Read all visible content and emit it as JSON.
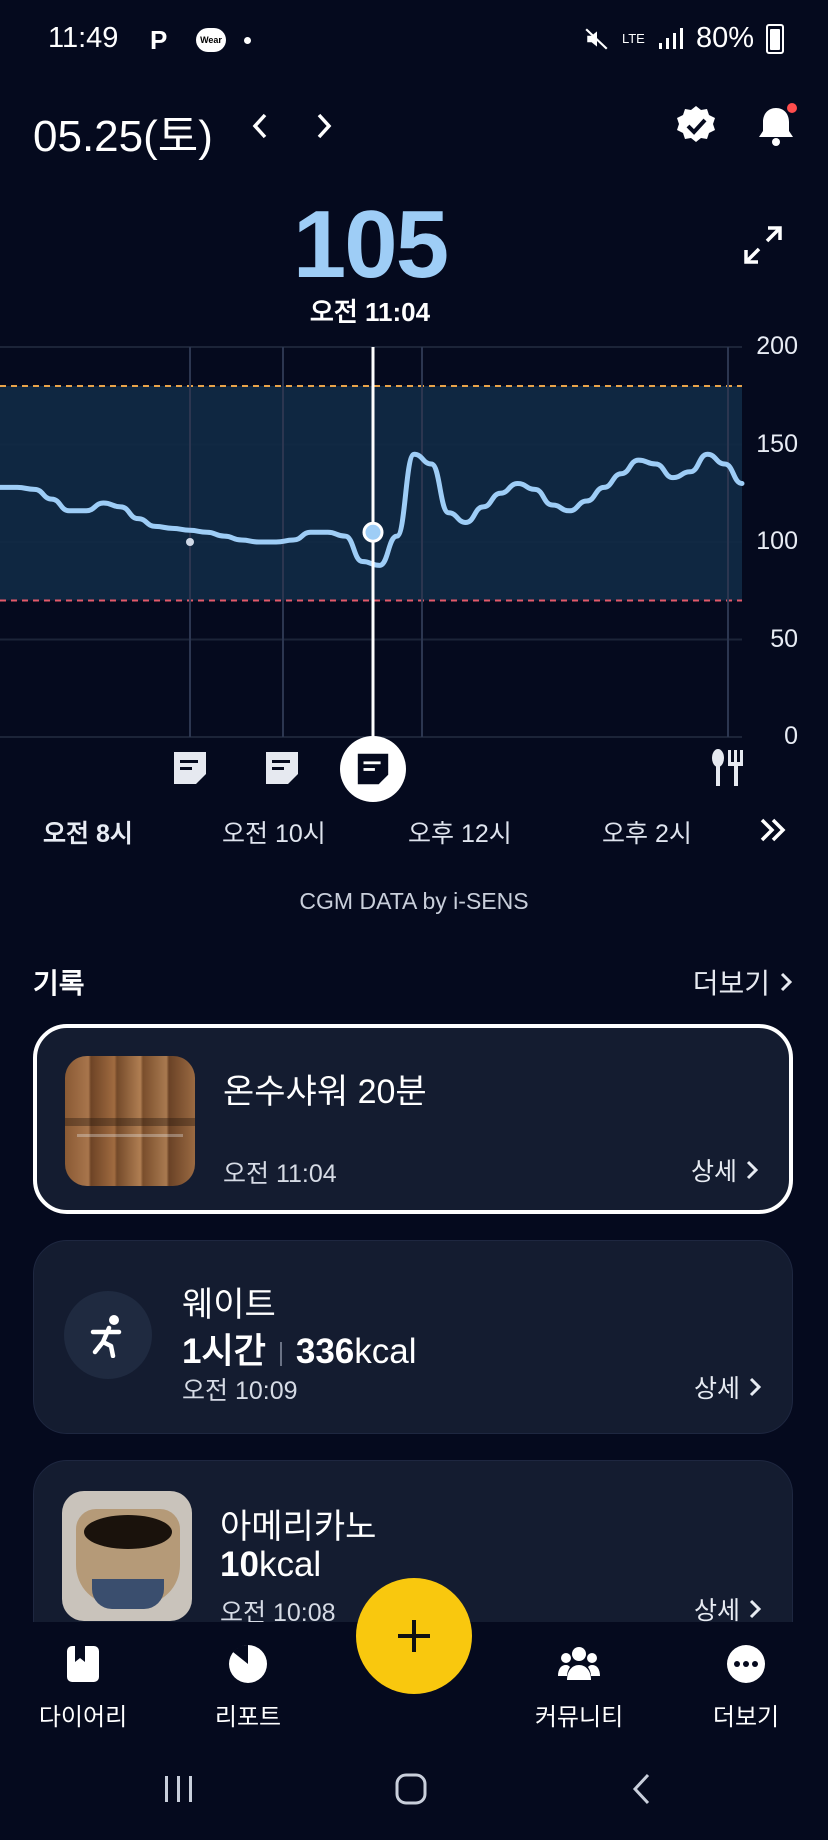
{
  "status_bar": {
    "time": "11:49",
    "wear_label": "Wear",
    "network": "LTE",
    "battery": "80%"
  },
  "header": {
    "date": "05.25(토)",
    "prev_icon": "chevron-left-icon",
    "next_icon": "chevron-right-icon",
    "badge_icon": "verified-badge-icon",
    "bell_icon": "bell-icon"
  },
  "glucose": {
    "value": "105",
    "time": "오전 11:04"
  },
  "chart_data": {
    "type": "line",
    "y_ticks": [
      "200",
      "150",
      "100",
      "50",
      "0"
    ],
    "ylim": [
      0,
      200
    ],
    "target_range": [
      70,
      180
    ],
    "x_ticks": [
      "오전 8시",
      "오전 10시",
      "오후 12시",
      "오후 2시"
    ],
    "selected_time": "오전 11:04",
    "selected_value": 105,
    "series": [
      {
        "values": [
          128,
          128,
          127,
          122,
          116,
          116,
          120,
          118,
          112,
          108,
          107,
          106,
          105,
          103,
          101,
          100,
          100,
          101,
          105,
          105,
          103,
          90,
          88,
          103,
          145,
          140,
          115,
          110,
          118,
          125,
          130,
          127,
          119,
          116,
          121,
          128,
          135,
          142,
          140,
          133,
          136,
          145,
          140,
          130
        ]
      }
    ],
    "markers": [
      "note-icon",
      "note-icon",
      "note-icon",
      "meal-icon"
    ],
    "colors": {
      "line": "#9ecdf6",
      "range_fill": "#112a45",
      "upper_limit": "#e8a34a",
      "lower_limit": "#e35a6a"
    }
  },
  "cgm_credit": "CGM DATA by i-SENS",
  "records": {
    "title": "기록",
    "more": "더보기",
    "items": [
      {
        "title": "온수샤워 20분",
        "time": "오전 11:04",
        "detail": "상세"
      },
      {
        "title": "웨이트",
        "duration": "1시간",
        "kcal_value": "336",
        "kcal_unit": "kcal",
        "time": "오전 10:09",
        "detail": "상세",
        "icon": "running-person-icon"
      },
      {
        "title": "아메리카노",
        "kcal_value": "10",
        "kcal_unit": "kcal",
        "time": "오전 10:08",
        "detail": "상세"
      }
    ]
  },
  "bottom_nav": {
    "items": [
      {
        "label": "다이어리",
        "icon": "diary-icon"
      },
      {
        "label": "리포트",
        "icon": "report-icon"
      },
      {
        "label": "커뮤니티",
        "icon": "community-icon"
      },
      {
        "label": "더보기",
        "icon": "more-icon"
      }
    ],
    "fab_icon": "plus-icon"
  }
}
